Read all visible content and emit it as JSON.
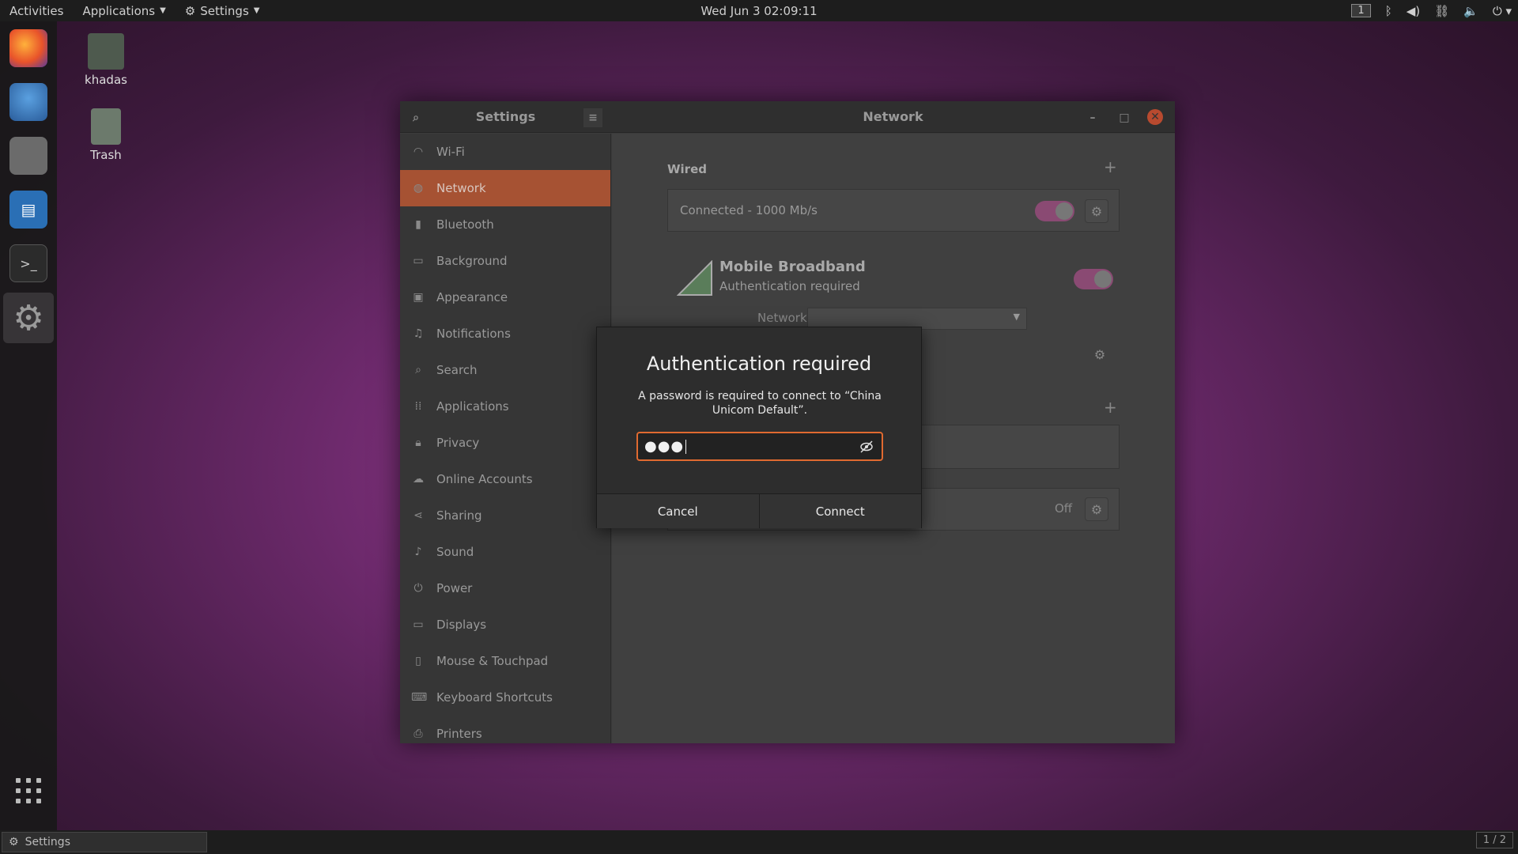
{
  "topbar": {
    "activities": "Activities",
    "applications": "Applications",
    "settings": "Settings",
    "clock": "Wed Jun 3  02:09:11",
    "workspace": "1"
  },
  "desktop": {
    "home_label": "khadas",
    "trash_label": "Trash"
  },
  "bottombar": {
    "task_label": "Settings",
    "pager": "1 / 2"
  },
  "window": {
    "left_title": "Settings",
    "right_title": "Network"
  },
  "sidebar": {
    "items": [
      {
        "label": "Wi-Fi",
        "icon": "wifi-icon"
      },
      {
        "label": "Network",
        "icon": "network-icon"
      },
      {
        "label": "Bluetooth",
        "icon": "bluetooth-icon"
      },
      {
        "label": "Background",
        "icon": "background-icon"
      },
      {
        "label": "Appearance",
        "icon": "appearance-icon"
      },
      {
        "label": "Notifications",
        "icon": "bell-icon"
      },
      {
        "label": "Search",
        "icon": "search-icon"
      },
      {
        "label": "Applications",
        "icon": "apps-icon"
      },
      {
        "label": "Privacy",
        "icon": "lock-icon"
      },
      {
        "label": "Online Accounts",
        "icon": "cloud-icon"
      },
      {
        "label": "Sharing",
        "icon": "share-icon"
      },
      {
        "label": "Sound",
        "icon": "music-icon"
      },
      {
        "label": "Power",
        "icon": "power-icon"
      },
      {
        "label": "Displays",
        "icon": "display-icon"
      },
      {
        "label": "Mouse & Touchpad",
        "icon": "mouse-icon"
      },
      {
        "label": "Keyboard Shortcuts",
        "icon": "keyboard-icon"
      },
      {
        "label": "Printers",
        "icon": "printer-icon"
      }
    ]
  },
  "network": {
    "wired_title": "Wired",
    "wired_status": "Connected - 1000 Mb/s",
    "mobile_title": "Mobile Broadband",
    "mobile_subtitle": "Authentication required",
    "network_label": "Network",
    "off_label": "Off"
  },
  "dialog": {
    "title": "Authentication required",
    "message": "A password is required to connect to “China Unicom Default”.",
    "password_mask": "●●●",
    "cancel": "Cancel",
    "connect": "Connect"
  },
  "colors": {
    "accent": "#e06a30",
    "selected_sidebar": "#a65233"
  }
}
